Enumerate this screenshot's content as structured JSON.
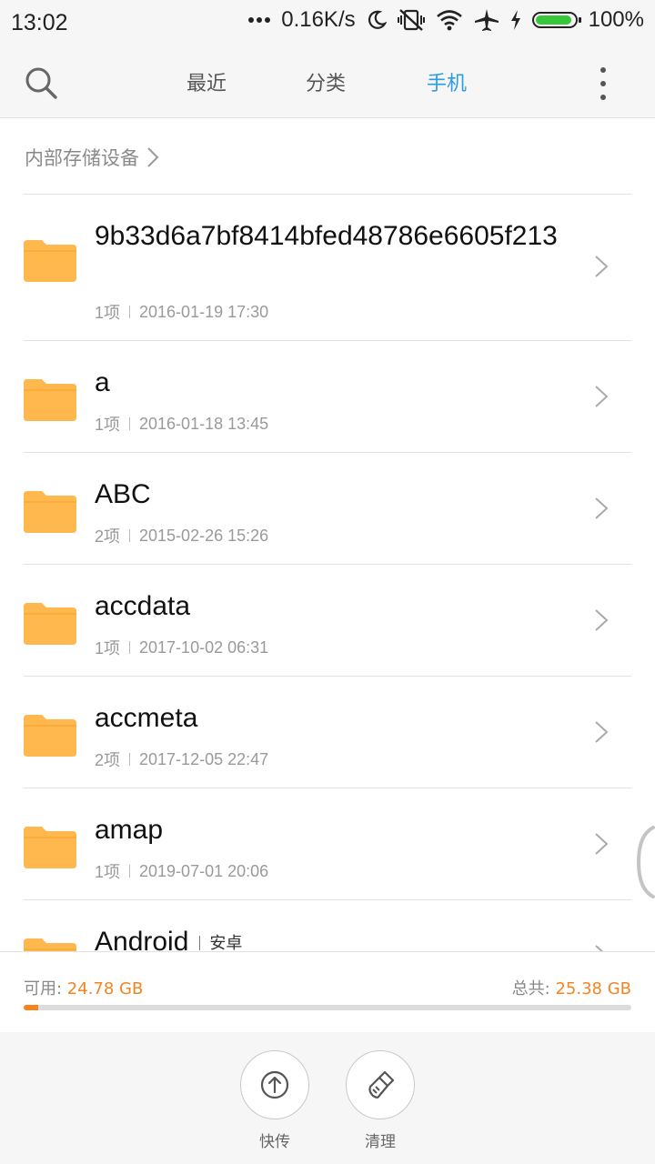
{
  "status_bar": {
    "time": "13:02",
    "network_speed": "0.16K/s",
    "battery_percent": "100%",
    "battery_level": 1.0,
    "icons": [
      "more-dots-icon",
      "moon-icon",
      "vibrate-off-icon",
      "wifi-icon",
      "airplane-icon",
      "charging-icon",
      "battery-icon"
    ]
  },
  "topbar": {
    "tabs": [
      {
        "label": "最近"
      },
      {
        "label": "分类"
      },
      {
        "label": "手机"
      }
    ],
    "active_tab": "手机",
    "accent": "#2d9ce8"
  },
  "breadcrumb": {
    "label": "内部存储设备"
  },
  "folders": [
    {
      "name": "9b33d6a7bf8414bfed48786e6605f213",
      "count": "1项",
      "date": "2016-01-19 17:30"
    },
    {
      "name": "a",
      "count": "1项",
      "date": "2016-01-18 13:45"
    },
    {
      "name": "ABC",
      "count": "2项",
      "date": "2015-02-26 15:26"
    },
    {
      "name": "accdata",
      "count": "1项",
      "date": "2017-10-02 06:31"
    },
    {
      "name": "accmeta",
      "count": "2项",
      "date": "2017-12-05 22:47"
    },
    {
      "name": "amap",
      "count": "1项",
      "date": "2019-07-01 20:06"
    },
    {
      "name": "Android",
      "tag": "安卓"
    }
  ],
  "storage": {
    "available_label": "可用: ",
    "available_value": "24.78 GB",
    "total_label": "总共: ",
    "total_value": "25.38 GB",
    "used_fraction": 0.024,
    "accent": "#f5841f"
  },
  "actions": [
    {
      "label": "快传",
      "icon": "upload-icon"
    },
    {
      "label": "清理",
      "icon": "broom-icon"
    }
  ],
  "colors": {
    "folder": "#ffb84d",
    "folder_tab": "#f5a22d"
  }
}
